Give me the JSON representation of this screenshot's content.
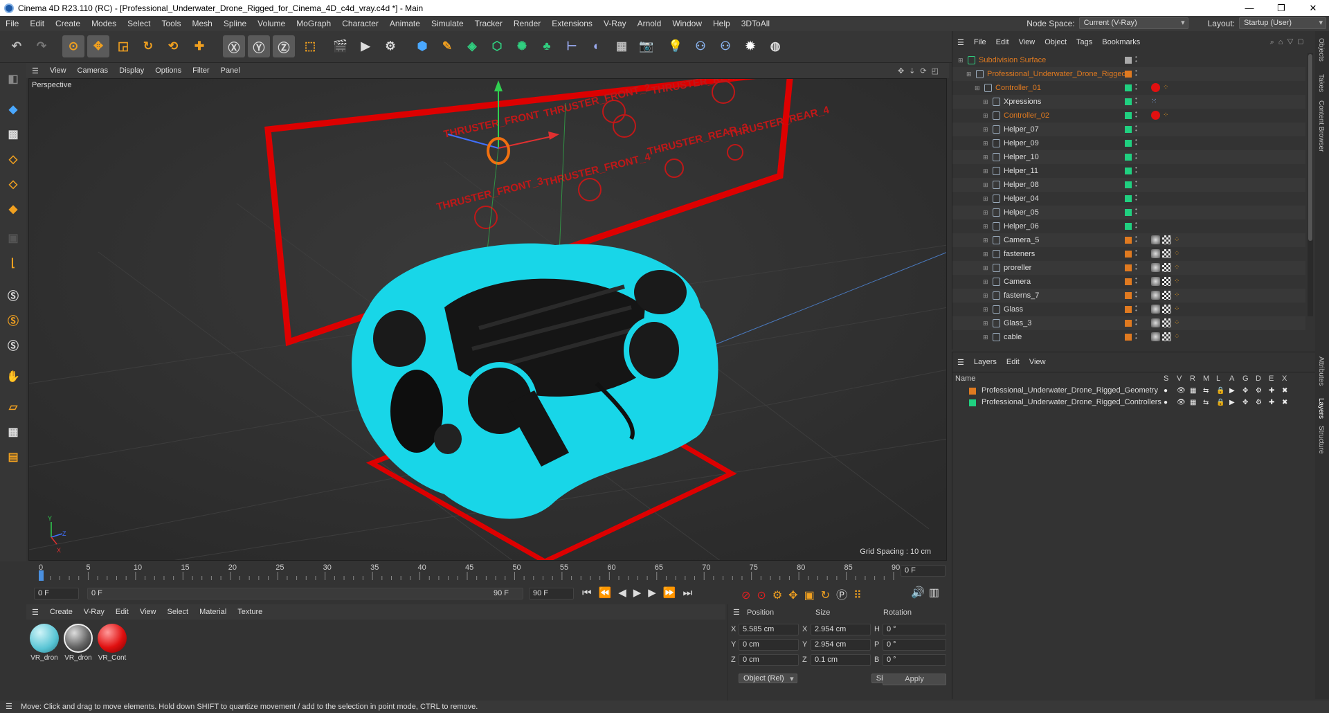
{
  "window": {
    "title": "Cinema 4D R23.110 (RC) - [Professional_Underwater_Drone_Rigged_for_Cinema_4D_c4d_vray.c4d *] - Main",
    "minimize": "—",
    "maximize": "❐",
    "close": "✕"
  },
  "menubar": {
    "items": [
      "File",
      "Edit",
      "Create",
      "Modes",
      "Select",
      "Tools",
      "Mesh",
      "Spline",
      "Volume",
      "MoGraph",
      "Character",
      "Animate",
      "Simulate",
      "Tracker",
      "Render",
      "Extensions",
      "V-Ray",
      "Arnold",
      "Window",
      "Help",
      "3DToAll"
    ],
    "node_space_label": "Node Space:",
    "node_space_value": "Current (V-Ray)",
    "layout_label": "Layout:",
    "layout_value": "Startup (User)"
  },
  "viewport": {
    "menu": [
      "View",
      "Cameras",
      "Display",
      "Options",
      "Filter",
      "Panel"
    ],
    "label": "Perspective",
    "grid_spacing": "Grid Spacing : 10 cm",
    "thruster_labels": [
      "THRUSTER_FRONT",
      "THRUSTER_FRONT_2",
      "THRUSTER_REAR",
      "THRUSTER_FRONT_3",
      "THRUSTER_FRONT_4",
      "THRUSTER_REAR_3",
      "THRUSTER_REAR_4"
    ]
  },
  "timeline": {
    "ticks": [
      "0",
      "5",
      "10",
      "15",
      "20",
      "25",
      "30",
      "35",
      "40",
      "45",
      "50",
      "55",
      "60",
      "65",
      "70",
      "75",
      "80",
      "85",
      "90"
    ],
    "current_frame": "0 F"
  },
  "transport": {
    "start": "0 F",
    "range_start": "0 F",
    "range_end": "90 F",
    "end": "90 F"
  },
  "materials": {
    "menu": [
      "Create",
      "V-Ray",
      "Edit",
      "View",
      "Select",
      "Material",
      "Texture"
    ],
    "items": [
      {
        "name": "VR_dron",
        "color": "#7fd3e0"
      },
      {
        "name": "VR_dron",
        "color": "#777777"
      },
      {
        "name": "VR_Cont",
        "color": "#e01010"
      }
    ]
  },
  "coords": {
    "position_label": "Position",
    "size_label": "Size",
    "rotation_label": "Rotation",
    "px": "5.585 cm",
    "py": "0 cm",
    "pz": "0 cm",
    "sx": "2.954 cm",
    "sy": "2.954 cm",
    "sz": "0.1 cm",
    "rh": "0 °",
    "rp": "0 °",
    "rb": "0 °",
    "axis_x": "X",
    "axis_y": "Y",
    "axis_z": "Z",
    "rot_h": "H",
    "rot_p": "P",
    "rot_b": "B",
    "mode": "Object (Rel)",
    "size_mode": "Size",
    "apply": "Apply"
  },
  "objects": {
    "menu": [
      "File",
      "Edit",
      "View",
      "Object",
      "Tags",
      "Bookmarks"
    ],
    "rows": [
      {
        "name": "Subdivision Surface",
        "color": "#e07a20",
        "indent": 0
      },
      {
        "name": "Professional_Underwater_Drone_Rigged",
        "color": "#e07a20",
        "indent": 1
      },
      {
        "name": "Controller_01",
        "color": "#e07a20",
        "indent": 2
      },
      {
        "name": "Xpressions",
        "color": "#dddddd",
        "indent": 3
      },
      {
        "name": "Controller_02",
        "color": "#e07a20",
        "indent": 3
      },
      {
        "name": "Helper_07",
        "color": "#dddddd",
        "indent": 3
      },
      {
        "name": "Helper_09",
        "color": "#dddddd",
        "indent": 3
      },
      {
        "name": "Helper_10",
        "color": "#dddddd",
        "indent": 3
      },
      {
        "name": "Helper_11",
        "color": "#dddddd",
        "indent": 3
      },
      {
        "name": "Helper_08",
        "color": "#dddddd",
        "indent": 3
      },
      {
        "name": "Helper_04",
        "color": "#dddddd",
        "indent": 3
      },
      {
        "name": "Helper_05",
        "color": "#dddddd",
        "indent": 3
      },
      {
        "name": "Helper_06",
        "color": "#dddddd",
        "indent": 3
      },
      {
        "name": "Camera_5",
        "color": "#dddddd",
        "indent": 3
      },
      {
        "name": "fasteners",
        "color": "#dddddd",
        "indent": 3
      },
      {
        "name": "proreller",
        "color": "#dddddd",
        "indent": 3
      },
      {
        "name": "Camera",
        "color": "#dddddd",
        "indent": 3
      },
      {
        "name": "fasterns_7",
        "color": "#dddddd",
        "indent": 3
      },
      {
        "name": "Glass",
        "color": "#dddddd",
        "indent": 3
      },
      {
        "name": "Glass_3",
        "color": "#dddddd",
        "indent": 3
      },
      {
        "name": "cable",
        "color": "#dddddd",
        "indent": 3
      }
    ]
  },
  "layers": {
    "menu": [
      "Layers",
      "Edit",
      "View"
    ],
    "name_header": "Name",
    "column_headers": [
      "S",
      "V",
      "R",
      "M",
      "L",
      "A",
      "G",
      "D",
      "E",
      "X"
    ],
    "rows": [
      {
        "name": "Professional_Underwater_Drone_Rigged_Geometry",
        "color": "#e07a20"
      },
      {
        "name": "Professional_Underwater_Drone_Rigged_Controllers",
        "color": "#20d080"
      }
    ]
  },
  "side_tabs": [
    "Objects",
    "Takes",
    "Content Browser",
    "Attributes",
    "Layers",
    "Structure"
  ],
  "status": "Move: Click and drag to move elements. Hold down SHIFT to quantize movement / add to the selection in point mode, CTRL to remove."
}
